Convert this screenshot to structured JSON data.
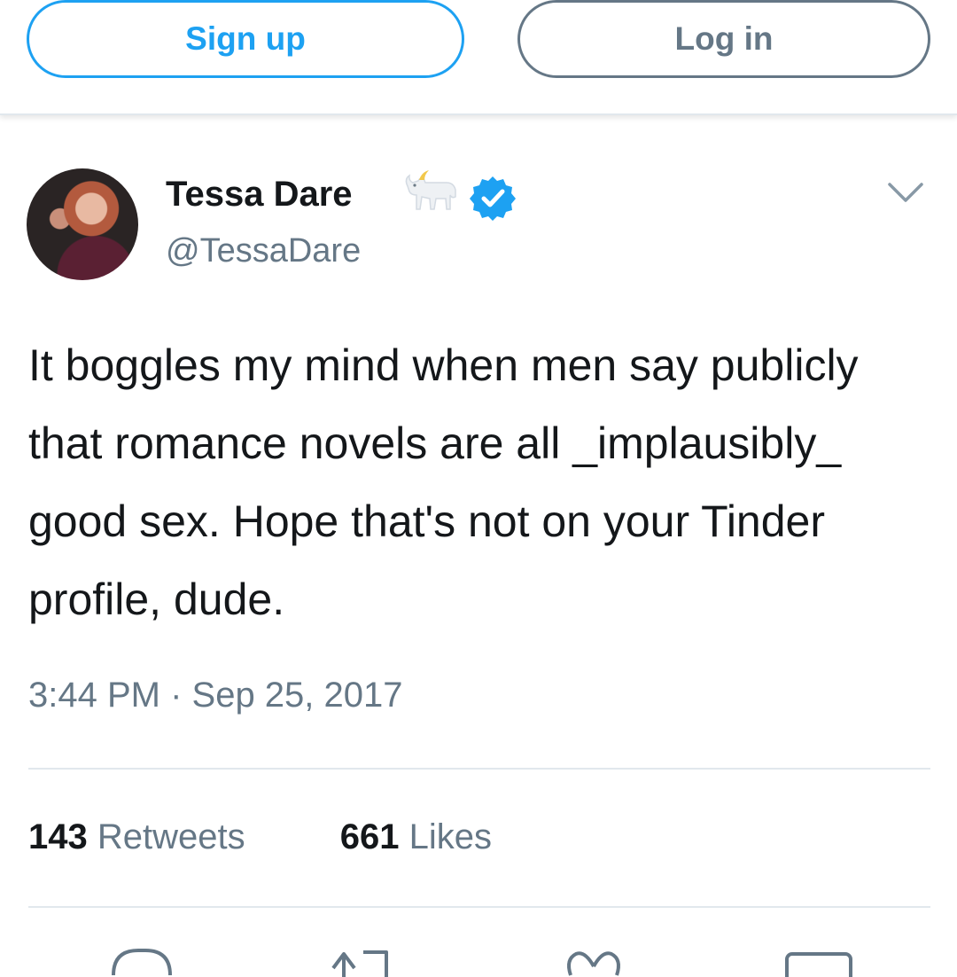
{
  "header": {
    "signup_label": "Sign up",
    "login_label": "Log in"
  },
  "tweet": {
    "author_name": "Tessa Dare",
    "author_handle": "@TessaDare",
    "text": "It boggles my mind when men say publicly that romance novels are all _implausibly_ good sex. Hope that's not on your Tinder profile, dude.",
    "timestamp": "3:44 PM · Sep 25, 2017"
  },
  "stats": {
    "retweets_count": "143",
    "retweets_label": "Retweets",
    "likes_count": "661",
    "likes_label": "Likes"
  },
  "icons": {
    "name_emoji": "goat-icon",
    "badge": "verified-badge-icon",
    "menu": "chevron-down-icon",
    "actions": [
      "reply-icon",
      "retweet-icon",
      "like-icon",
      "message-icon"
    ]
  },
  "colors": {
    "brand_blue": "#1da1f2",
    "secondary_text": "#657786",
    "primary_text": "#14171a",
    "divider": "#e1e8ed"
  }
}
